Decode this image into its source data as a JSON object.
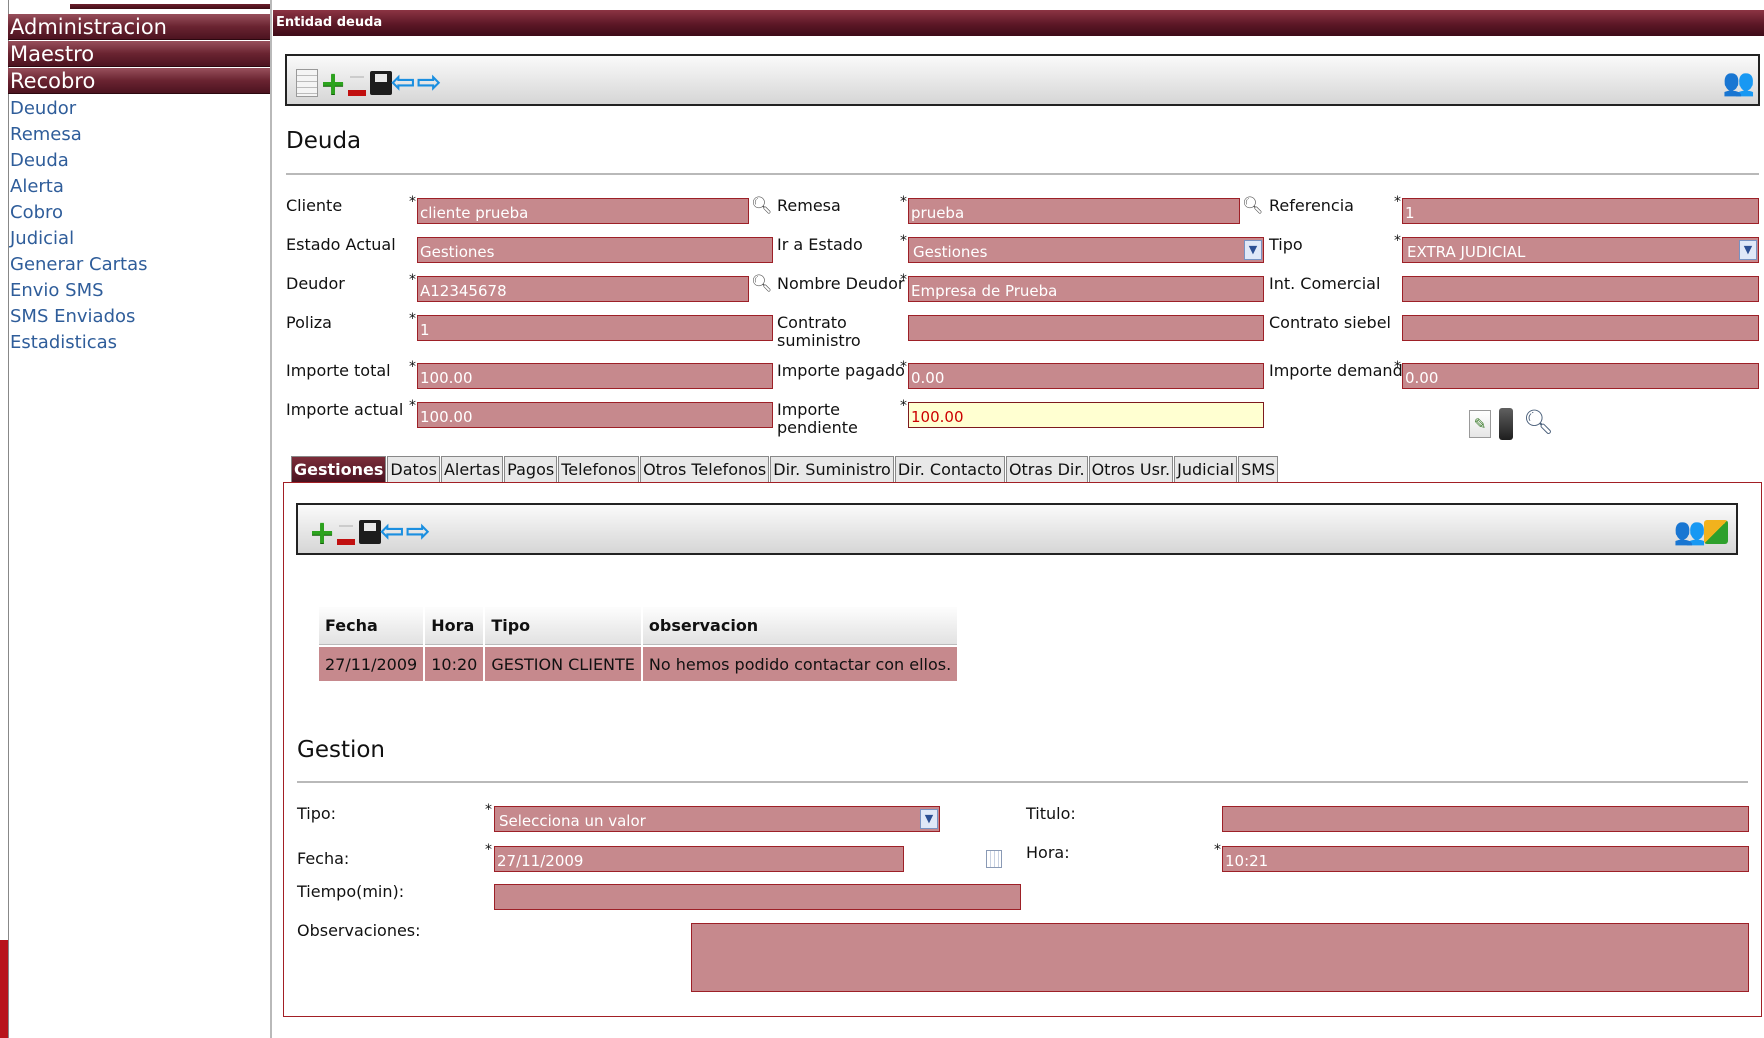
{
  "sidebar": {
    "sections": [
      "Administracion",
      "Maestro",
      "Recobro"
    ],
    "items": [
      "Deudor",
      "Remesa",
      "Deuda",
      "Alerta",
      "Cobro",
      "Judicial",
      "Generar Cartas",
      "Envio SMS",
      "SMS Enviados",
      "Estadisticas"
    ]
  },
  "header": {
    "title": "Entidad deuda"
  },
  "page_title": "Deuda",
  "form": {
    "cliente": {
      "label": "Cliente",
      "value": "cliente prueba"
    },
    "remesa": {
      "label": "Remesa",
      "value": "prueba"
    },
    "referencia": {
      "label": "Referencia",
      "value": "1"
    },
    "estado_actual": {
      "label": "Estado Actual",
      "value": "Gestiones"
    },
    "ir_a_estado": {
      "label": "Ir a Estado",
      "value": "Gestiones"
    },
    "tipo": {
      "label": "Tipo",
      "value": "EXTRA JUDICIAL"
    },
    "deudor": {
      "label": "Deudor",
      "value": "A12345678"
    },
    "nombre_deudor": {
      "label": "Nombre Deudor",
      "value": "Empresa de Prueba"
    },
    "int_comercial": {
      "label": "Int. Comercial",
      "value": ""
    },
    "poliza": {
      "label": "Poliza",
      "value": "1"
    },
    "contrato_suministro": {
      "label1": "Contrato",
      "label2": "suministro",
      "value": ""
    },
    "contrato_siebel": {
      "label": "Contrato siebel",
      "value": ""
    },
    "importe_total": {
      "label": "Importe total",
      "value": "100.00"
    },
    "importe_pagado": {
      "label": "Importe pagado",
      "value": "0.00"
    },
    "importe_demanda": {
      "label": "Importe demanda",
      "value": "0.00"
    },
    "importe_actual": {
      "label": "Importe actual",
      "value": "100.00"
    },
    "importe_pendiente": {
      "label1": "Importe",
      "label2": "pendiente",
      "value": "100.00"
    },
    "required_mark": "*"
  },
  "tabs": [
    "Gestiones",
    "Datos",
    "Alertas",
    "Pagos",
    "Telefonos",
    "Otros Telefonos",
    "Dir. Suministro",
    "Dir. Contacto",
    "Otras Dir.",
    "Otros Usr.",
    "Judicial",
    "SMS"
  ],
  "active_tab": "Gestiones",
  "table": {
    "headers": [
      "Fecha",
      "Hora",
      "Tipo",
      "observacion"
    ],
    "rows": [
      [
        "27/11/2009",
        "10:20",
        "GESTION CLIENTE",
        "No hemos podido contactar con ellos."
      ]
    ]
  },
  "gestion": {
    "title": "Gestion",
    "tipo": {
      "label": "Tipo:",
      "value": "Selecciona un valor"
    },
    "titulo": {
      "label": "Titulo:",
      "value": ""
    },
    "fecha": {
      "label": "Fecha:",
      "value": "27/11/2009"
    },
    "hora": {
      "label": "Hora:",
      "value": "10:21"
    },
    "tiempo": {
      "label": "Tiempo(min):",
      "value": ""
    },
    "observaciones": {
      "label": "Observaciones:",
      "value": ""
    }
  },
  "icons": {
    "main_toolbar": [
      "list-icon",
      "add-icon",
      "delete-icon",
      "save-icon",
      "back-arrow-icon",
      "forward-arrow-icon",
      "users-icon"
    ],
    "tab_toolbar": [
      "add-icon",
      "delete-icon",
      "save-icon",
      "back-arrow-icon",
      "forward-arrow-icon",
      "users-icon",
      "export-icon"
    ],
    "form_actions": [
      "edit-note-icon",
      "mobile-phone-icon",
      "search-icon"
    ]
  },
  "colors": {
    "header_dark": "#4c1320",
    "field_bg": "#c6898d",
    "field_border": "#9d2027",
    "highlight_bg": "#ffffd1",
    "link": "#2f5d9a"
  }
}
